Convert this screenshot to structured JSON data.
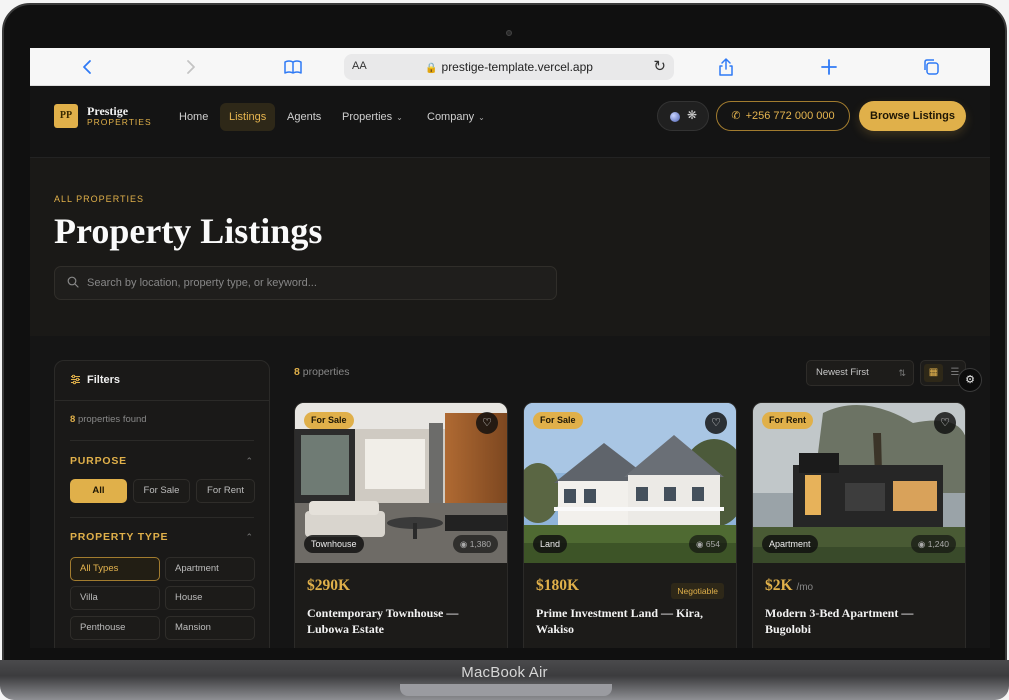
{
  "device": {
    "model": "MacBook Air"
  },
  "browser": {
    "text_size": "AA",
    "url": "prestige-template.vercel.app"
  },
  "brand": {
    "mark": "PP",
    "name": "Prestige",
    "sub": "PROPERTIES"
  },
  "nav": {
    "items": [
      {
        "label": "Home"
      },
      {
        "label": "Listings"
      },
      {
        "label": "Agents"
      },
      {
        "label": "Properties"
      },
      {
        "label": "Company"
      }
    ],
    "phone": "+256 772 000 000",
    "cta": "Browse Listings"
  },
  "hero": {
    "eyebrow": "ALL PROPERTIES",
    "title": "Property Listings",
    "search_placeholder": "Search by location, property type, or keyword..."
  },
  "filters": {
    "title": "Filters",
    "found_count": "8",
    "found_text": "properties found",
    "purpose": {
      "heading": "PURPOSE",
      "options": [
        "All",
        "For Sale",
        "For Rent"
      ]
    },
    "property_type": {
      "heading": "PROPERTY TYPE",
      "options": [
        "All Types",
        "Apartment",
        "Villa",
        "House",
        "Penthouse",
        "Mansion"
      ]
    }
  },
  "results": {
    "count": "8",
    "count_text": "properties",
    "sort": "Newest First"
  },
  "listings": [
    {
      "badge": "For Sale",
      "type": "Townhouse",
      "views": "1,380",
      "price": "$290K",
      "price_unit": "",
      "tag": "",
      "title": "Contemporary Townhouse — Lubowa Estate"
    },
    {
      "badge": "For Sale",
      "type": "Land",
      "views": "654",
      "price": "$180K",
      "price_unit": "",
      "tag": "Negotiable",
      "title": "Prime Investment Land — Kira, Wakiso"
    },
    {
      "badge": "For Rent",
      "type": "Apartment",
      "views": "1,240",
      "price": "$2K",
      "price_unit": "/mo",
      "tag": "",
      "title": "Modern 3-Bed Apartment — Bugolobi"
    }
  ],
  "colors": {
    "accent": "#e0b04a",
    "background": "#151515",
    "surface": "#1c1b19"
  }
}
